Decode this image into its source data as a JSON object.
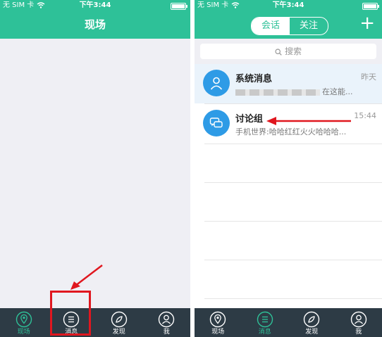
{
  "left_screen": {
    "status": {
      "carrier": "无 SIM 卡 ",
      "time": "下午3:44"
    },
    "title": "现场",
    "tabs": [
      {
        "label": "现场",
        "icon": "location-pin-icon"
      },
      {
        "label": "消息",
        "icon": "message-list-icon"
      },
      {
        "label": "发现",
        "icon": "discover-icon"
      },
      {
        "label": "我",
        "icon": "profile-icon"
      }
    ],
    "active_tab": "现场"
  },
  "right_screen": {
    "status": {
      "carrier": "无 SIM 卡 ",
      "time": "下午3:44"
    },
    "segment": {
      "selected": "会话",
      "other": "关注"
    },
    "add_icon": "plus-icon",
    "search": {
      "placeholder": "搜索"
    },
    "conversations": [
      {
        "name": "系统消息",
        "time": "昨天",
        "preview": "在这能...",
        "icon": "person-icon"
      },
      {
        "name": "讨论组",
        "time": "15:44",
        "preview": "手机世界:哈哈红红火火哈哈哈...",
        "icon": "chat-bubbles-icon"
      }
    ],
    "tabs": [
      {
        "label": "现场",
        "icon": "location-pin-icon"
      },
      {
        "label": "消息",
        "icon": "message-list-icon"
      },
      {
        "label": "发现",
        "icon": "discover-icon"
      },
      {
        "label": "我",
        "icon": "profile-icon"
      }
    ],
    "active_tab": "消息"
  },
  "colors": {
    "brand": "#2ec198",
    "tabbar": "#2d3b45",
    "avatar": "#2e9be6",
    "annotation": "#e0171f"
  }
}
